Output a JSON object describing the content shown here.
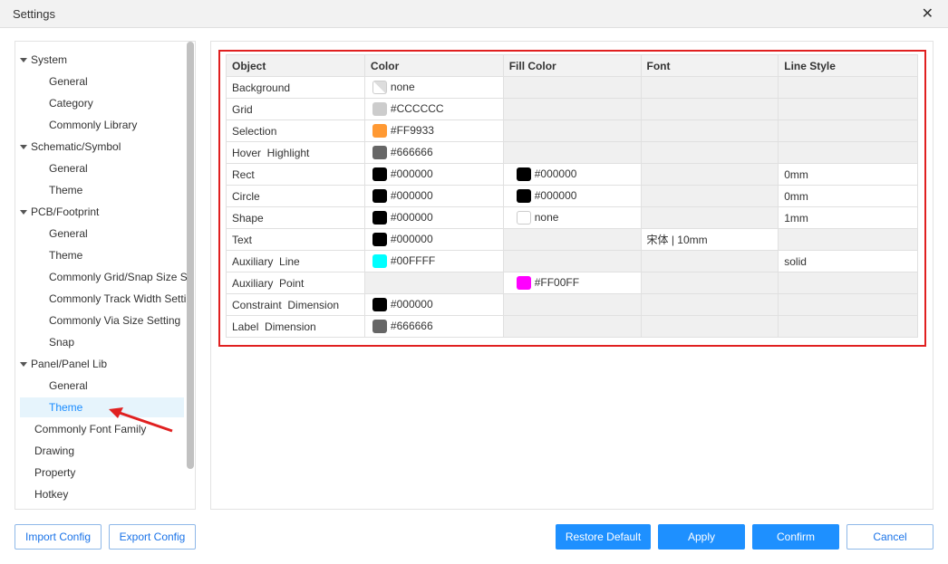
{
  "window": {
    "title": "Settings"
  },
  "sidebar": {
    "items": [
      {
        "label": "System",
        "level": 0,
        "group": true
      },
      {
        "label": "General",
        "level": 1
      },
      {
        "label": "Category",
        "level": 1
      },
      {
        "label": "Commonly Library",
        "level": 1
      },
      {
        "label": "Schematic/Symbol",
        "level": 0,
        "group": true
      },
      {
        "label": "General",
        "level": 1
      },
      {
        "label": "Theme",
        "level": 1
      },
      {
        "label": "PCB/Footprint",
        "level": 0,
        "group": true
      },
      {
        "label": "General",
        "level": 1
      },
      {
        "label": "Theme",
        "level": 1
      },
      {
        "label": "Commonly Grid/Snap Size S",
        "level": 1
      },
      {
        "label": "Commonly Track Width Setti",
        "level": 1
      },
      {
        "label": "Commonly Via Size Setting",
        "level": 1
      },
      {
        "label": "Snap",
        "level": 1
      },
      {
        "label": "Panel/Panel Lib",
        "level": 0,
        "group": true
      },
      {
        "label": "General",
        "level": 1
      },
      {
        "label": "Theme",
        "level": 1,
        "active": true
      },
      {
        "label": "Commonly Font Family",
        "level": 0
      },
      {
        "label": "Drawing",
        "level": 0
      },
      {
        "label": "Property",
        "level": 0
      },
      {
        "label": "Hotkey",
        "level": 0
      }
    ]
  },
  "table": {
    "headers": [
      "Object",
      "Color",
      "Fill Color",
      "Font",
      "Line Style"
    ],
    "rows": [
      {
        "object": "Background",
        "color": {
          "value": "none",
          "hex": "none"
        },
        "fill": null,
        "font": null,
        "line": null,
        "editable": [
          1,
          0,
          0,
          0
        ]
      },
      {
        "object": "Grid",
        "color": {
          "value": "#CCCCCC",
          "hex": "#CCCCCC"
        },
        "fill": null,
        "font": null,
        "line": null,
        "editable": [
          1,
          0,
          0,
          0
        ]
      },
      {
        "object": "Selection",
        "color": {
          "value": "#FF9933",
          "hex": "#FF9933"
        },
        "fill": null,
        "font": null,
        "line": null,
        "editable": [
          1,
          0,
          0,
          0
        ]
      },
      {
        "object": "Hover  Highlight",
        "color": {
          "value": "#666666",
          "hex": "#666666"
        },
        "fill": null,
        "font": null,
        "line": null,
        "editable": [
          1,
          0,
          0,
          0
        ]
      },
      {
        "object": "Rect",
        "color": {
          "value": "#000000",
          "hex": "#000000"
        },
        "fill": {
          "value": "#000000",
          "hex": "#000000"
        },
        "font": null,
        "line": "0mm",
        "editable": [
          1,
          1,
          0,
          1
        ]
      },
      {
        "object": "Circle",
        "color": {
          "value": "#000000",
          "hex": "#000000"
        },
        "fill": {
          "value": "#000000",
          "hex": "#000000"
        },
        "font": null,
        "line": "0mm",
        "editable": [
          1,
          1,
          0,
          1
        ]
      },
      {
        "object": "Shape",
        "color": {
          "value": "#000000",
          "hex": "#000000"
        },
        "fill": {
          "value": "none",
          "hex": "#FFFFFF"
        },
        "font": null,
        "line": "1mm",
        "editable": [
          1,
          1,
          0,
          1
        ]
      },
      {
        "object": "Text",
        "color": {
          "value": "#000000",
          "hex": "#000000"
        },
        "fill": null,
        "font": "宋体 | 10mm",
        "line": null,
        "editable": [
          1,
          0,
          1,
          0
        ]
      },
      {
        "object": "Auxiliary  Line",
        "color": {
          "value": "#00FFFF",
          "hex": "#00FFFF"
        },
        "fill": null,
        "font": null,
        "line": "solid",
        "editable": [
          1,
          0,
          0,
          1
        ]
      },
      {
        "object": "Auxiliary  Point",
        "color": null,
        "fill": {
          "value": "#FF00FF",
          "hex": "#FF00FF"
        },
        "font": null,
        "line": null,
        "editable": [
          0,
          1,
          0,
          0
        ]
      },
      {
        "object": "Constraint  Dimension",
        "color": {
          "value": "#000000",
          "hex": "#000000"
        },
        "fill": null,
        "font": null,
        "line": null,
        "editable": [
          1,
          0,
          0,
          0
        ]
      },
      {
        "object": "Label  Dimension",
        "color": {
          "value": "#666666",
          "hex": "#666666"
        },
        "fill": null,
        "font": null,
        "line": null,
        "editable": [
          1,
          0,
          0,
          0
        ]
      }
    ]
  },
  "footer": {
    "import": "Import Config",
    "export": "Export Config",
    "restore": "Restore Default",
    "apply": "Apply",
    "confirm": "Confirm",
    "cancel": "Cancel"
  },
  "colors": {
    "accent": "#1E90FF",
    "highlight_box": "#E02020"
  }
}
